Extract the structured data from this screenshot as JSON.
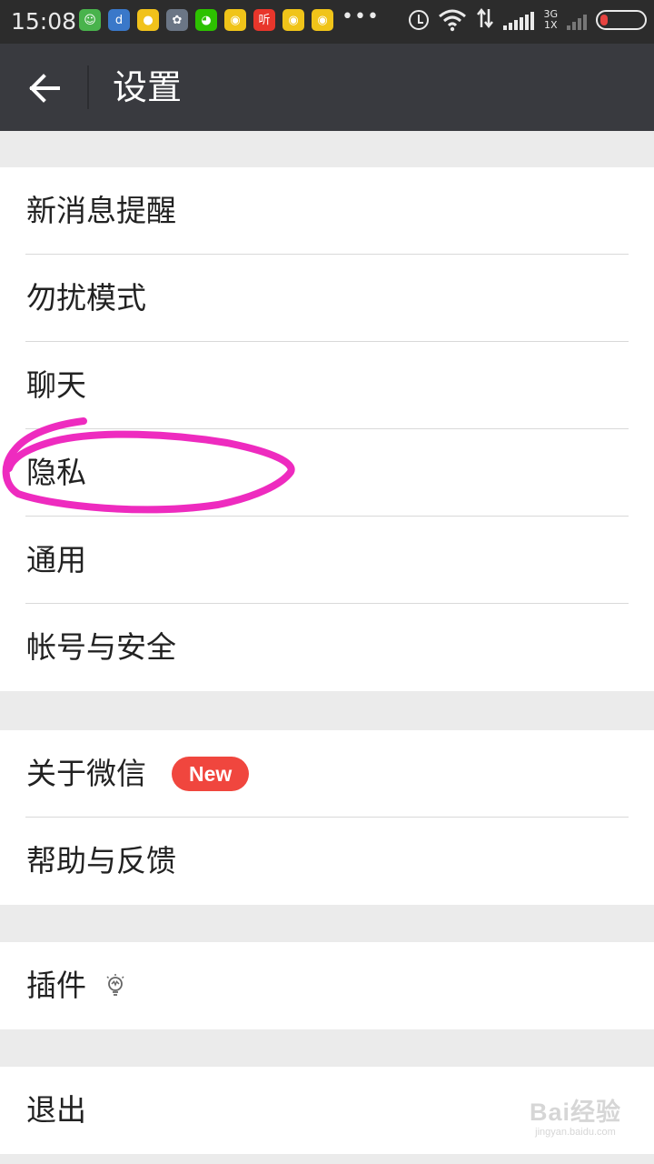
{
  "status_bar": {
    "time": "15:08",
    "app_icons": [
      {
        "icon": "app-icon-green",
        "glyph": "☺",
        "color": "#49b34c"
      },
      {
        "icon": "app-icon-blue",
        "glyph": "d",
        "color": "#3a78c9"
      },
      {
        "icon": "app-icon-yellow",
        "glyph": "●",
        "color": "#f1c21b"
      },
      {
        "icon": "app-icon-gray",
        "glyph": "✿",
        "color": "#6b7685"
      },
      {
        "icon": "wechat-icon",
        "glyph": "◕",
        "color": "#2dc100"
      },
      {
        "icon": "weibo-icon",
        "glyph": "◉",
        "color": "#f0c419"
      },
      {
        "icon": "ting-icon",
        "glyph": "听",
        "color": "#e8362b"
      },
      {
        "icon": "weibo-icon",
        "glyph": "◉",
        "color": "#f0c419"
      },
      {
        "icon": "weibo-icon",
        "glyph": "◉",
        "color": "#f0c419"
      }
    ],
    "more_indicator": "•••",
    "network_top": "3G",
    "network_bottom": "1X"
  },
  "header": {
    "back_icon": "arrow-left-icon",
    "title": "设置"
  },
  "groups": [
    {
      "items": [
        {
          "label": "新消息提醒"
        },
        {
          "label": "勿扰模式"
        },
        {
          "label": "聊天"
        },
        {
          "label": "隐私"
        },
        {
          "label": "通用"
        },
        {
          "label": "帐号与安全"
        }
      ]
    },
    {
      "items": [
        {
          "label": "关于微信",
          "badge": "New"
        },
        {
          "label": "帮助与反馈"
        }
      ]
    },
    {
      "items": [
        {
          "label": "插件",
          "icon": "lightbulb-icon"
        }
      ]
    },
    {
      "items": [
        {
          "label": "退出"
        }
      ]
    }
  ],
  "annotation": {
    "color": "#ee2bbf",
    "target": "隐私"
  },
  "watermark": {
    "main": "Bai经验",
    "sub": "jingyan.baidu.com"
  }
}
